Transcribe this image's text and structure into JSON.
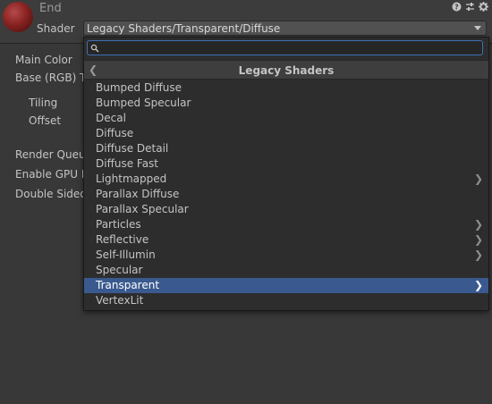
{
  "header": {
    "title": "End",
    "shader_label": "Shader",
    "shader_value": "Legacy Shaders/Transparent/Diffuse",
    "icons": [
      "help-icon",
      "settings-sliders-icon",
      "gear-icon"
    ]
  },
  "properties": {
    "main_color": "Main Color",
    "base_texture": "Base (RGB) T",
    "tiling": "Tiling",
    "offset": "Offset",
    "render_queue": "Render Queue",
    "enable_gpu": "Enable GPU In",
    "double_sided": "Double Sided"
  },
  "popup": {
    "search": {
      "value": "",
      "placeholder": ""
    },
    "breadcrumb": "Legacy Shaders",
    "items": [
      {
        "label": "Bumped Diffuse",
        "submenu": false,
        "selected": false
      },
      {
        "label": "Bumped Specular",
        "submenu": false,
        "selected": false
      },
      {
        "label": "Decal",
        "submenu": false,
        "selected": false
      },
      {
        "label": "Diffuse",
        "submenu": false,
        "selected": false
      },
      {
        "label": "Diffuse Detail",
        "submenu": false,
        "selected": false
      },
      {
        "label": "Diffuse Fast",
        "submenu": false,
        "selected": false
      },
      {
        "label": "Lightmapped",
        "submenu": true,
        "selected": false
      },
      {
        "label": "Parallax Diffuse",
        "submenu": false,
        "selected": false
      },
      {
        "label": "Parallax Specular",
        "submenu": false,
        "selected": false
      },
      {
        "label": "Particles",
        "submenu": true,
        "selected": false
      },
      {
        "label": "Reflective",
        "submenu": true,
        "selected": false
      },
      {
        "label": "Self-Illumin",
        "submenu": true,
        "selected": false
      },
      {
        "label": "Specular",
        "submenu": false,
        "selected": false
      },
      {
        "label": "Transparent",
        "submenu": true,
        "selected": true
      },
      {
        "label": "VertexLit",
        "submenu": false,
        "selected": false
      }
    ]
  },
  "colors": {
    "background": "#383838",
    "popup_background": "#2d2d2d",
    "selection": "#3a5a8f",
    "search_focus": "#3e72b5"
  }
}
